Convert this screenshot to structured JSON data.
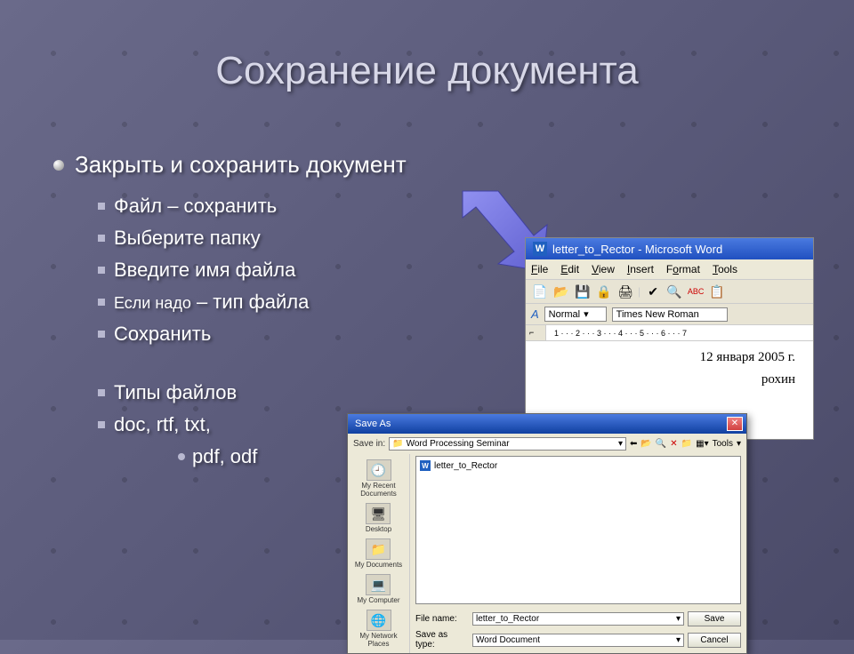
{
  "title": "Сохранение документа",
  "main_bullet": "Закрыть и сохранить документ",
  "subs": {
    "s1": "Файл – сохранить",
    "s2": "Выберите папку",
    "s3": "Введите имя файла",
    "s4_pre": "Если надо",
    "s4_post": " – тип файла",
    "s5": "Сохранить",
    "s6": "Типы файлов",
    "s7": "doc, rtf, txt,",
    "s8": "pdf, odf"
  },
  "word": {
    "title": "letter_to_Rector - Microsoft Word",
    "menu": {
      "file": "File",
      "edit": "Edit",
      "view": "View",
      "insert": "Insert",
      "format": "Format",
      "tools": "Tools"
    },
    "style": "Normal",
    "font": "Times New Roman",
    "date": "12 января 2005 г.",
    "name_fragment": "рохин"
  },
  "dialog": {
    "title": "Save As",
    "save_in_label": "Save in:",
    "save_in_value": "Word Processing Seminar",
    "tools_label": "Tools",
    "places": {
      "recent": "My Recent Documents",
      "desktop": "Desktop",
      "mydocs": "My Documents",
      "mycomp": "My Computer",
      "network": "My Network Places"
    },
    "file_shown": "letter_to_Rector",
    "file_name_label": "File name:",
    "file_name_value": "letter_to_Rector",
    "save_type_label": "Save as type:",
    "save_type_value": "Word Document",
    "save_btn": "Save",
    "cancel_btn": "Cancel"
  }
}
